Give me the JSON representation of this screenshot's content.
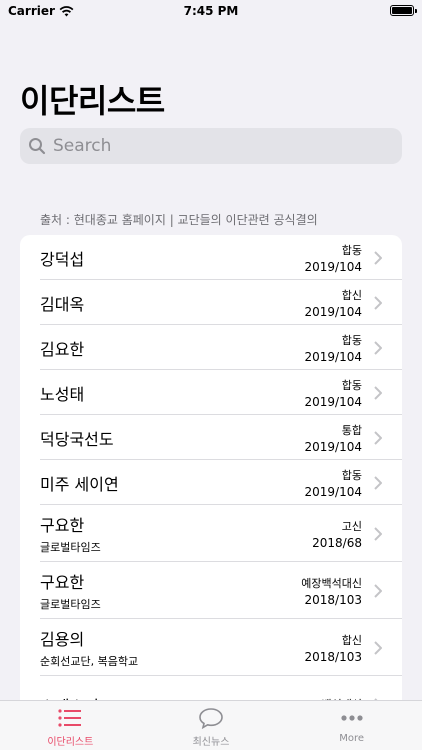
{
  "status_bar": {
    "carrier": "Carrier",
    "time": "7:45 PM"
  },
  "title": "이단리스트",
  "search": {
    "placeholder": "Search"
  },
  "section_header": "출처 : 현대종교 홈페이지 | 교단들의 이단관련 공식결의",
  "items": [
    {
      "name": "강덕섭",
      "sub": "",
      "tag": "합동",
      "ref": "2019/104"
    },
    {
      "name": "김대옥",
      "sub": "",
      "tag": "합신",
      "ref": "2019/104"
    },
    {
      "name": "김요한",
      "sub": "",
      "tag": "합동",
      "ref": "2019/104"
    },
    {
      "name": "노성태",
      "sub": "",
      "tag": "합동",
      "ref": "2019/104"
    },
    {
      "name": "덕당국선도",
      "sub": "",
      "tag": "통합",
      "ref": "2019/104"
    },
    {
      "name": "미주 세이연",
      "sub": "",
      "tag": "합동",
      "ref": "2019/104"
    },
    {
      "name": "구요한",
      "sub": "글로벌타임즈",
      "tag": "고신",
      "ref": "2018/68"
    },
    {
      "name": "구요한",
      "sub": "글로벌타임즈",
      "tag": "예장백석대신",
      "ref": "2018/103"
    },
    {
      "name": "김용의",
      "sub": "순회선교단, 복음학교",
      "tag": "합신",
      "ref": "2018/103"
    },
    {
      "name": "소에스더",
      "sub": "",
      "tag": "백석대신",
      "ref": ""
    }
  ],
  "tabs": [
    {
      "label": "이단리스트",
      "icon": "list-icon",
      "active": true
    },
    {
      "label": "최신뉴스",
      "icon": "chat-bubble-icon",
      "active": false
    },
    {
      "label": "More",
      "icon": "more-icon",
      "active": false
    }
  ],
  "colors": {
    "accent": "#e84a68",
    "inactive": "#8e8e93",
    "background": "#f2f1f6"
  }
}
